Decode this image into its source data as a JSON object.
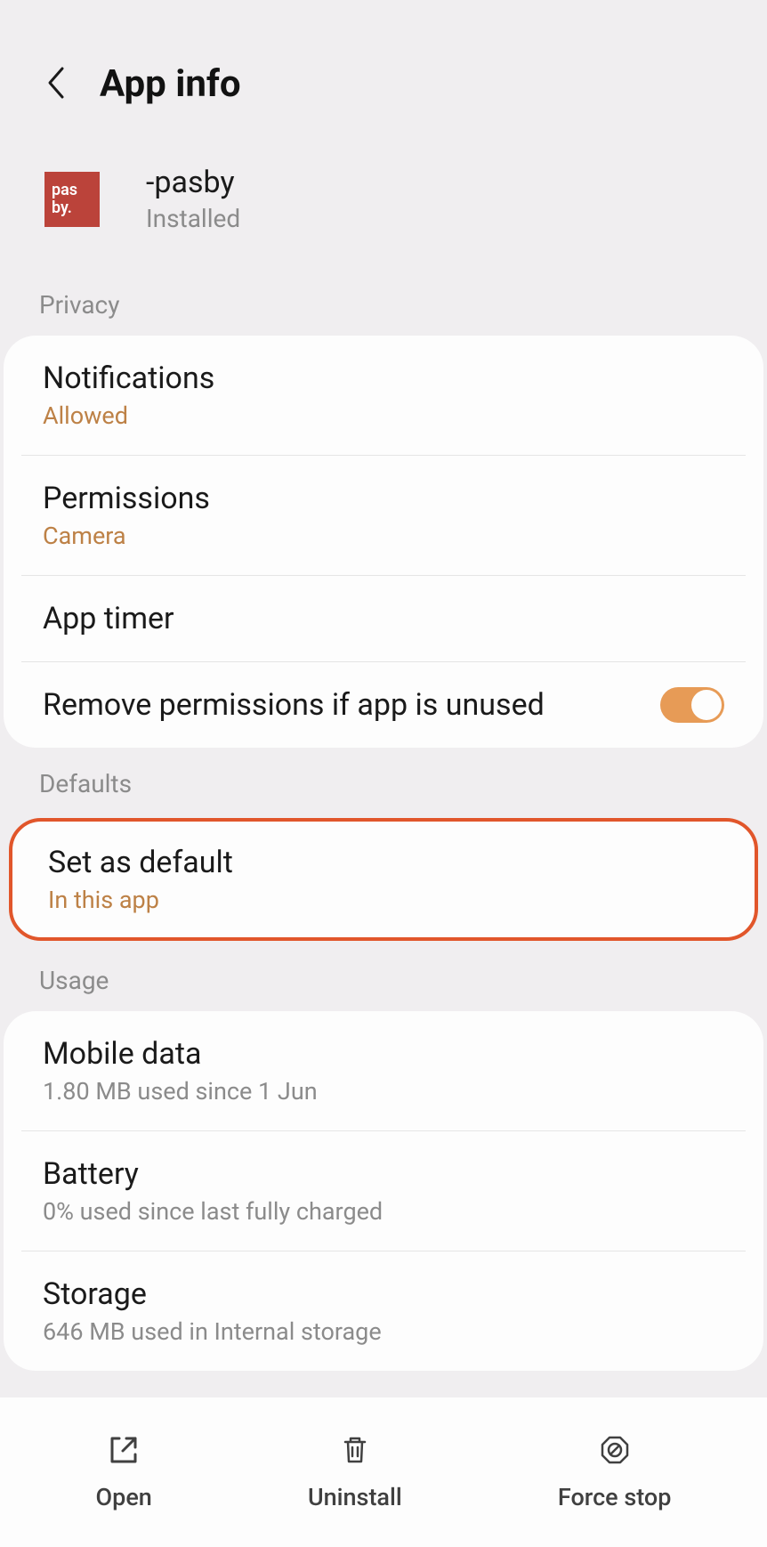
{
  "header": {
    "title": "App info"
  },
  "app": {
    "icon_line1": "pas",
    "icon_line2": "by.",
    "name": "-pasby",
    "status": "Installed"
  },
  "sections": {
    "privacy_label": "Privacy",
    "defaults_label": "Defaults",
    "usage_label": "Usage"
  },
  "privacy": {
    "notifications": {
      "title": "Notifications",
      "subtitle": "Allowed"
    },
    "permissions": {
      "title": "Permissions",
      "subtitle": "Camera"
    },
    "app_timer": {
      "title": "App timer"
    },
    "remove_permissions": {
      "title": "Remove permissions if app is unused",
      "toggle": true
    }
  },
  "defaults": {
    "set_as_default": {
      "title": "Set as default",
      "subtitle": "In this app"
    }
  },
  "usage": {
    "mobile_data": {
      "title": "Mobile data",
      "subtitle": "1.80 MB used since 1 Jun"
    },
    "battery": {
      "title": "Battery",
      "subtitle": "0% used since last fully charged"
    },
    "storage": {
      "title": "Storage",
      "subtitle": "646 MB used in Internal storage"
    }
  },
  "bottom_nav": {
    "open": "Open",
    "uninstall": "Uninstall",
    "force_stop": "Force stop"
  }
}
